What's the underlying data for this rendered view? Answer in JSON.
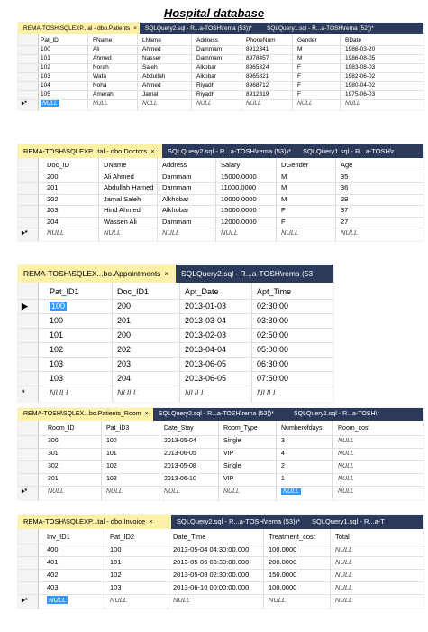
{
  "title": "Hospital database",
  "panels": [
    {
      "tabs": [
        {
          "label": "REMA-TOSH\\SQLEXP...al - dbo.Patients",
          "active": true,
          "close": "×"
        },
        {
          "label": "SQLQuery2.sql - R...a-TOSH\\rema (53))*",
          "active": false,
          "close": ""
        },
        {
          "label": "SQLQuery1.sql - R...a-TOSH\\rema (52))*",
          "active": false,
          "close": ""
        }
      ],
      "columns": [
        "Pat_ID",
        "FName",
        "LName",
        "Address",
        "PhoneNum",
        "Gender",
        "BDate"
      ],
      "rows": [
        {
          "marker": "",
          "cells": [
            "100",
            "Ali",
            "Ahmed",
            "Dammam",
            "8912341",
            "M",
            "1986-03-20"
          ]
        },
        {
          "marker": "",
          "cells": [
            "101",
            "Ahmed",
            "Nasser",
            "Dammam",
            "8978457",
            "M",
            "1986-08-05"
          ]
        },
        {
          "marker": "",
          "cells": [
            "102",
            "Norah",
            "Saleh",
            "Alkobar",
            "8965324",
            "F",
            "1983-08-03"
          ]
        },
        {
          "marker": "",
          "cells": [
            "103",
            "Wafa",
            "Abdullah",
            "Alkobar",
            "8965821",
            "F",
            "1982-06-02"
          ]
        },
        {
          "marker": "",
          "cells": [
            "104",
            "Noha",
            "Ahmed",
            "Riyadh",
            "8968712",
            "F",
            "1980-04-02"
          ]
        },
        {
          "marker": "",
          "cells": [
            "105",
            "Amerah",
            "Jamal",
            "Riyadh",
            "8912319",
            "F",
            "1975-06-03"
          ]
        },
        {
          "marker": "▸*",
          "cells": [
            "NULL",
            "NULL",
            "NULL",
            "NULL",
            "NULL",
            "NULL",
            "NULL"
          ]
        }
      ]
    },
    {
      "tabs": [
        {
          "label": "REMA-TOSH\\SQLEXP...tal - dbo.Doctors",
          "active": true,
          "close": "×"
        },
        {
          "label": "SQLQuery2.sql - R...a-TOSH\\rema (53))*",
          "active": false,
          "close": ""
        },
        {
          "label": "SQLQuery1.sql - R...a-TOSH\\r",
          "active": false,
          "close": ""
        }
      ],
      "columns": [
        "Doc_ID",
        "DName",
        "Address",
        "Salary",
        "DGender",
        "Age"
      ],
      "rows": [
        {
          "marker": "",
          "cells": [
            "200",
            "Ali Ahmed",
            "Dammam",
            "15000.0000",
            "M",
            "35"
          ]
        },
        {
          "marker": "",
          "cells": [
            "201",
            "Abdullah Hamed",
            "Dammam",
            "11000.0000",
            "M",
            "36"
          ]
        },
        {
          "marker": "",
          "cells": [
            "202",
            "Jamal Saleh",
            "Alkhobar",
            "10000.0000",
            "M",
            "29"
          ]
        },
        {
          "marker": "",
          "cells": [
            "203",
            "Hind Ahmed",
            "Alkhobar",
            "15000.0000",
            "F",
            "37"
          ]
        },
        {
          "marker": "",
          "cells": [
            "204",
            "Wassen Ali",
            "Dammam",
            "12000.0000",
            "F",
            "27"
          ]
        },
        {
          "marker": "▸*",
          "cells": [
            "NULL",
            "NULL",
            "NULL",
            "NULL",
            "NULL",
            "NULL"
          ]
        }
      ]
    },
    {
      "tabs": [
        {
          "label": "REMA-TOSH\\SQLEX...bo.Appointments",
          "active": true,
          "close": "×"
        },
        {
          "label": "SQLQuery2.sql - R...a-TOSH\\rema (53",
          "active": false,
          "close": ""
        }
      ],
      "columns": [
        "Pat_ID1",
        "Doc_ID1",
        "Apt_Date",
        "Apt_Time"
      ],
      "rows": [
        {
          "marker": "▶",
          "cells": [
            "100",
            "200",
            "2013-01-03",
            "02:30:00"
          ]
        },
        {
          "marker": "",
          "cells": [
            "100",
            "201",
            "2013-03-04",
            "03:30:00"
          ]
        },
        {
          "marker": "",
          "cells": [
            "101",
            "200",
            "2013-02-03",
            "02:50:00"
          ]
        },
        {
          "marker": "",
          "cells": [
            "102",
            "202",
            "2013-04-04",
            "05:00:00"
          ]
        },
        {
          "marker": "",
          "cells": [
            "103",
            "203",
            "2013-06-05",
            "06:30:00"
          ]
        },
        {
          "marker": "",
          "cells": [
            "103",
            "204",
            "2013-06-05",
            "07:50:00"
          ]
        },
        {
          "marker": "*",
          "cells": [
            "NULL",
            "NULL",
            "NULL",
            "NULL"
          ]
        }
      ]
    },
    {
      "tabs": [
        {
          "label": "REMA-TOSH\\SQLEX...bo.Patients_Room",
          "active": true,
          "close": "×"
        },
        {
          "label": "SQLQuery2.sql - R...a-TOSH\\rema (53))*",
          "active": false,
          "close": ""
        },
        {
          "label": "SQLQuery1.sql - R...a-TOSH\\r",
          "active": false,
          "close": ""
        }
      ],
      "columns": [
        "Room_ID",
        "Pat_ID3",
        "Date_Stay",
        "Room_Type",
        "Numberofdays",
        "Room_cost"
      ],
      "rows": [
        {
          "marker": "",
          "cells": [
            "300",
            "100",
            "2013-05-04",
            "Single",
            "3",
            "NULL"
          ]
        },
        {
          "marker": "",
          "cells": [
            "301",
            "101",
            "2013-06-05",
            "VIP",
            "4",
            "NULL"
          ]
        },
        {
          "marker": "",
          "cells": [
            "302",
            "102",
            "2013-05-08",
            "Single",
            "2",
            "NULL"
          ]
        },
        {
          "marker": "",
          "cells": [
            "301",
            "103",
            "2013-06-10",
            "VIP",
            "1",
            "NULL"
          ]
        },
        {
          "marker": "▸*",
          "cells": [
            "NULL",
            "NULL",
            "NULL",
            "NULL",
            "NULL",
            "NULL"
          ]
        }
      ]
    },
    {
      "tabs": [
        {
          "label": "REMA-TOSH\\SQLEXP...tal - dbo.Invoice",
          "active": true,
          "close": "×"
        },
        {
          "label": "SQLQuery2.sql - R...a-TOSH\\rema (53))*",
          "active": false,
          "close": ""
        },
        {
          "label": "SQLQuery1.sql - R...a-T",
          "active": false,
          "close": ""
        }
      ],
      "columns": [
        "Inv_ID1",
        "Pat_ID2",
        "Date_Time",
        "Treatment_cost",
        "Total"
      ],
      "rows": [
        {
          "marker": "",
          "cells": [
            "400",
            "100",
            "2013-05-04 04:30:00.000",
            "100.0000",
            "NULL"
          ]
        },
        {
          "marker": "",
          "cells": [
            "401",
            "101",
            "2013-05-06 03:30:00.000",
            "200.0000",
            "NULL"
          ]
        },
        {
          "marker": "",
          "cells": [
            "402",
            "102",
            "2013-05-08 02:30:00.000",
            "150.0000",
            "NULL"
          ]
        },
        {
          "marker": "",
          "cells": [
            "403",
            "103",
            "2013-06-10 00:00:00.000",
            "100.0000",
            "NULL"
          ]
        },
        {
          "marker": "▸*",
          "cells": [
            "NULL",
            "NULL",
            "NULL",
            "NULL",
            "NULL"
          ]
        }
      ]
    }
  ]
}
